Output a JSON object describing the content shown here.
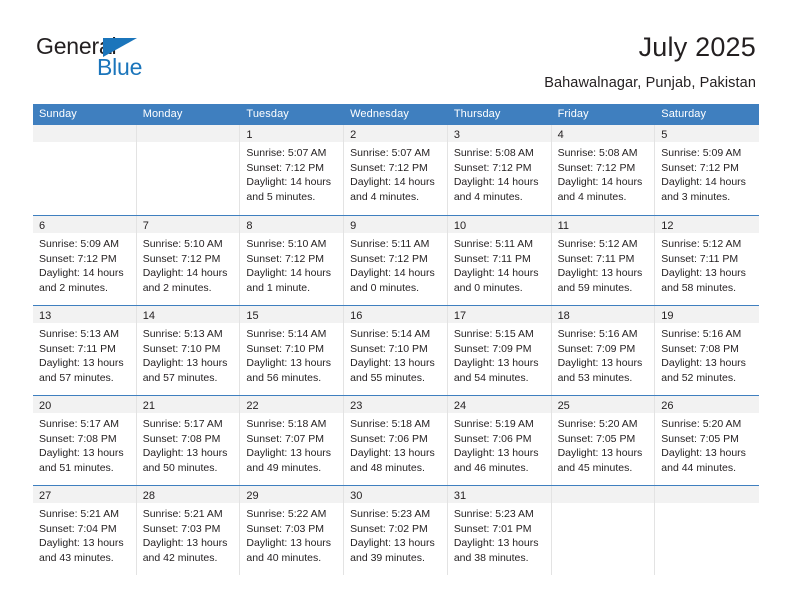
{
  "brand": {
    "name_top": "General",
    "name_bottom": "Blue",
    "color_blue": "#1b75bb",
    "color_dark": "#231f20",
    "triangle_icon": "triangle-icon"
  },
  "header": {
    "title": "July 2025",
    "location": "Bahawalnagar, Punjab, Pakistan"
  },
  "theme": {
    "header_blue": "#3f7fbf",
    "daynum_band": "#f2f2f2",
    "cell_border": "#e3e3e3",
    "text": "#231f20"
  },
  "weekdays": [
    "Sunday",
    "Monday",
    "Tuesday",
    "Wednesday",
    "Thursday",
    "Friday",
    "Saturday"
  ],
  "weeks": [
    [
      {
        "day": "",
        "sunrise": "",
        "sunset": "",
        "daylight1": "",
        "daylight2": "",
        "empty": true
      },
      {
        "day": "",
        "sunrise": "",
        "sunset": "",
        "daylight1": "",
        "daylight2": "",
        "empty": true
      },
      {
        "day": "1",
        "sunrise": "Sunrise: 5:07 AM",
        "sunset": "Sunset: 7:12 PM",
        "daylight1": "Daylight: 14 hours",
        "daylight2": "and 5 minutes."
      },
      {
        "day": "2",
        "sunrise": "Sunrise: 5:07 AM",
        "sunset": "Sunset: 7:12 PM",
        "daylight1": "Daylight: 14 hours",
        "daylight2": "and 4 minutes."
      },
      {
        "day": "3",
        "sunrise": "Sunrise: 5:08 AM",
        "sunset": "Sunset: 7:12 PM",
        "daylight1": "Daylight: 14 hours",
        "daylight2": "and 4 minutes."
      },
      {
        "day": "4",
        "sunrise": "Sunrise: 5:08 AM",
        "sunset": "Sunset: 7:12 PM",
        "daylight1": "Daylight: 14 hours",
        "daylight2": "and 4 minutes."
      },
      {
        "day": "5",
        "sunrise": "Sunrise: 5:09 AM",
        "sunset": "Sunset: 7:12 PM",
        "daylight1": "Daylight: 14 hours",
        "daylight2": "and 3 minutes."
      }
    ],
    [
      {
        "day": "6",
        "sunrise": "Sunrise: 5:09 AM",
        "sunset": "Sunset: 7:12 PM",
        "daylight1": "Daylight: 14 hours",
        "daylight2": "and 2 minutes."
      },
      {
        "day": "7",
        "sunrise": "Sunrise: 5:10 AM",
        "sunset": "Sunset: 7:12 PM",
        "daylight1": "Daylight: 14 hours",
        "daylight2": "and 2 minutes."
      },
      {
        "day": "8",
        "sunrise": "Sunrise: 5:10 AM",
        "sunset": "Sunset: 7:12 PM",
        "daylight1": "Daylight: 14 hours",
        "daylight2": "and 1 minute."
      },
      {
        "day": "9",
        "sunrise": "Sunrise: 5:11 AM",
        "sunset": "Sunset: 7:12 PM",
        "daylight1": "Daylight: 14 hours",
        "daylight2": "and 0 minutes."
      },
      {
        "day": "10",
        "sunrise": "Sunrise: 5:11 AM",
        "sunset": "Sunset: 7:11 PM",
        "daylight1": "Daylight: 14 hours",
        "daylight2": "and 0 minutes."
      },
      {
        "day": "11",
        "sunrise": "Sunrise: 5:12 AM",
        "sunset": "Sunset: 7:11 PM",
        "daylight1": "Daylight: 13 hours",
        "daylight2": "and 59 minutes."
      },
      {
        "day": "12",
        "sunrise": "Sunrise: 5:12 AM",
        "sunset": "Sunset: 7:11 PM",
        "daylight1": "Daylight: 13 hours",
        "daylight2": "and 58 minutes."
      }
    ],
    [
      {
        "day": "13",
        "sunrise": "Sunrise: 5:13 AM",
        "sunset": "Sunset: 7:11 PM",
        "daylight1": "Daylight: 13 hours",
        "daylight2": "and 57 minutes."
      },
      {
        "day": "14",
        "sunrise": "Sunrise: 5:13 AM",
        "sunset": "Sunset: 7:10 PM",
        "daylight1": "Daylight: 13 hours",
        "daylight2": "and 57 minutes."
      },
      {
        "day": "15",
        "sunrise": "Sunrise: 5:14 AM",
        "sunset": "Sunset: 7:10 PM",
        "daylight1": "Daylight: 13 hours",
        "daylight2": "and 56 minutes."
      },
      {
        "day": "16",
        "sunrise": "Sunrise: 5:14 AM",
        "sunset": "Sunset: 7:10 PM",
        "daylight1": "Daylight: 13 hours",
        "daylight2": "and 55 minutes."
      },
      {
        "day": "17",
        "sunrise": "Sunrise: 5:15 AM",
        "sunset": "Sunset: 7:09 PM",
        "daylight1": "Daylight: 13 hours",
        "daylight2": "and 54 minutes."
      },
      {
        "day": "18",
        "sunrise": "Sunrise: 5:16 AM",
        "sunset": "Sunset: 7:09 PM",
        "daylight1": "Daylight: 13 hours",
        "daylight2": "and 53 minutes."
      },
      {
        "day": "19",
        "sunrise": "Sunrise: 5:16 AM",
        "sunset": "Sunset: 7:08 PM",
        "daylight1": "Daylight: 13 hours",
        "daylight2": "and 52 minutes."
      }
    ],
    [
      {
        "day": "20",
        "sunrise": "Sunrise: 5:17 AM",
        "sunset": "Sunset: 7:08 PM",
        "daylight1": "Daylight: 13 hours",
        "daylight2": "and 51 minutes."
      },
      {
        "day": "21",
        "sunrise": "Sunrise: 5:17 AM",
        "sunset": "Sunset: 7:08 PM",
        "daylight1": "Daylight: 13 hours",
        "daylight2": "and 50 minutes."
      },
      {
        "day": "22",
        "sunrise": "Sunrise: 5:18 AM",
        "sunset": "Sunset: 7:07 PM",
        "daylight1": "Daylight: 13 hours",
        "daylight2": "and 49 minutes."
      },
      {
        "day": "23",
        "sunrise": "Sunrise: 5:18 AM",
        "sunset": "Sunset: 7:06 PM",
        "daylight1": "Daylight: 13 hours",
        "daylight2": "and 48 minutes."
      },
      {
        "day": "24",
        "sunrise": "Sunrise: 5:19 AM",
        "sunset": "Sunset: 7:06 PM",
        "daylight1": "Daylight: 13 hours",
        "daylight2": "and 46 minutes."
      },
      {
        "day": "25",
        "sunrise": "Sunrise: 5:20 AM",
        "sunset": "Sunset: 7:05 PM",
        "daylight1": "Daylight: 13 hours",
        "daylight2": "and 45 minutes."
      },
      {
        "day": "26",
        "sunrise": "Sunrise: 5:20 AM",
        "sunset": "Sunset: 7:05 PM",
        "daylight1": "Daylight: 13 hours",
        "daylight2": "and 44 minutes."
      }
    ],
    [
      {
        "day": "27",
        "sunrise": "Sunrise: 5:21 AM",
        "sunset": "Sunset: 7:04 PM",
        "daylight1": "Daylight: 13 hours",
        "daylight2": "and 43 minutes."
      },
      {
        "day": "28",
        "sunrise": "Sunrise: 5:21 AM",
        "sunset": "Sunset: 7:03 PM",
        "daylight1": "Daylight: 13 hours",
        "daylight2": "and 42 minutes."
      },
      {
        "day": "29",
        "sunrise": "Sunrise: 5:22 AM",
        "sunset": "Sunset: 7:03 PM",
        "daylight1": "Daylight: 13 hours",
        "daylight2": "and 40 minutes."
      },
      {
        "day": "30",
        "sunrise": "Sunrise: 5:23 AM",
        "sunset": "Sunset: 7:02 PM",
        "daylight1": "Daylight: 13 hours",
        "daylight2": "and 39 minutes."
      },
      {
        "day": "31",
        "sunrise": "Sunrise: 5:23 AM",
        "sunset": "Sunset: 7:01 PM",
        "daylight1": "Daylight: 13 hours",
        "daylight2": "and 38 minutes."
      },
      {
        "day": "",
        "sunrise": "",
        "sunset": "",
        "daylight1": "",
        "daylight2": "",
        "empty": true
      },
      {
        "day": "",
        "sunrise": "",
        "sunset": "",
        "daylight1": "",
        "daylight2": "",
        "empty": true
      }
    ]
  ]
}
